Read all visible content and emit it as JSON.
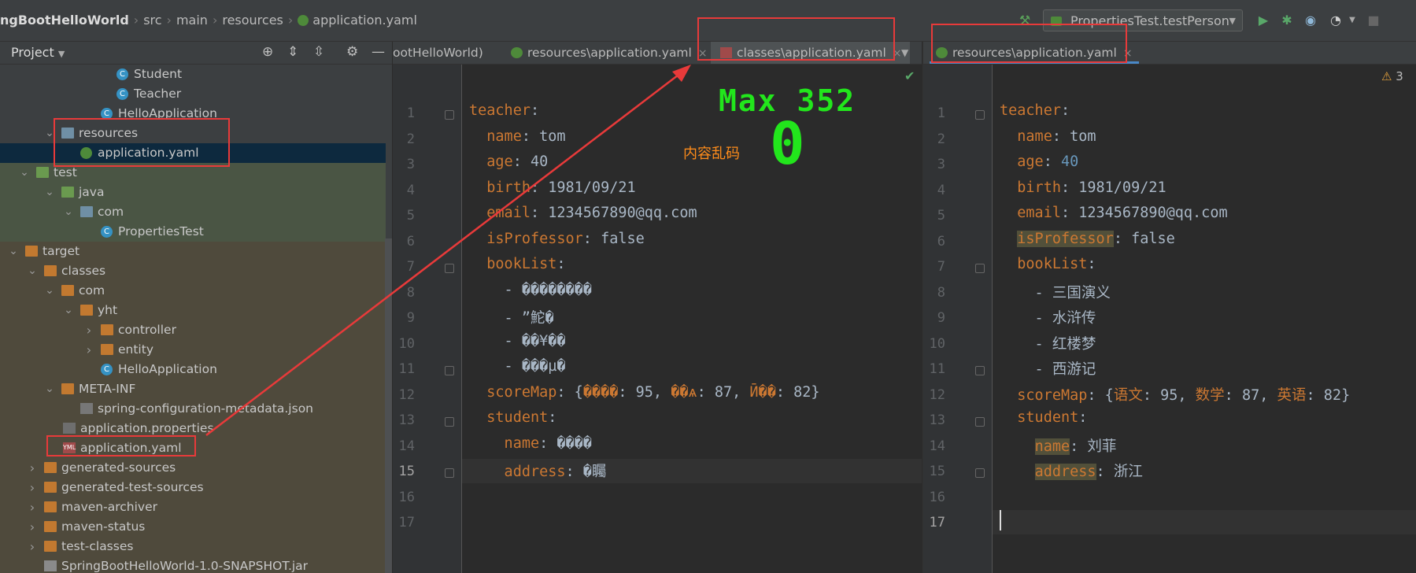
{
  "breadcrumb": {
    "project": "ngBootHelloWorld",
    "items": [
      "src",
      "main",
      "resources"
    ],
    "file": "application.yaml"
  },
  "toolbar": {
    "run_config": "PropertiesTest.testPerson"
  },
  "project_panel": {
    "title": "Project",
    "tree": [
      {
        "label": "Student",
        "icon": "class-icon",
        "indent": 148,
        "arrow": "",
        "bg": ""
      },
      {
        "label": "Teacher",
        "icon": "class-icon",
        "indent": 148,
        "arrow": "",
        "bg": ""
      },
      {
        "label": "HelloApplication",
        "icon": "spring-class-icon",
        "indent": 128,
        "arrow": "",
        "bg": ""
      },
      {
        "label": "resources",
        "icon": "resources-folder-icon",
        "indent": 78,
        "arrow": "▾",
        "bg": ""
      },
      {
        "label": "application.yaml",
        "icon": "spring-yaml-icon",
        "indent": 102,
        "arrow": "",
        "bg": "sel"
      },
      {
        "label": "test",
        "icon": "folder-green-icon",
        "indent": 46,
        "arrow": "▾",
        "bg": "green"
      },
      {
        "label": "java",
        "icon": "folder-green-icon",
        "indent": 78,
        "arrow": "▾",
        "bg": "green"
      },
      {
        "label": "com",
        "icon": "package-icon",
        "indent": 102,
        "arrow": "▾",
        "bg": "green"
      },
      {
        "label": "PropertiesTest",
        "icon": "spring-class-icon",
        "indent": 128,
        "arrow": "",
        "bg": "green"
      },
      {
        "label": "target",
        "icon": "folder-icon",
        "indent": 32,
        "arrow": "▾",
        "bg": "olive"
      },
      {
        "label": "classes",
        "icon": "folder-icon",
        "indent": 56,
        "arrow": "▾",
        "bg": "olive"
      },
      {
        "label": "com",
        "icon": "folder-icon",
        "indent": 78,
        "arrow": "▾",
        "bg": "olive"
      },
      {
        "label": "yht",
        "icon": "folder-icon",
        "indent": 102,
        "arrow": "▾",
        "bg": "olive"
      },
      {
        "label": "controller",
        "icon": "folder-icon",
        "indent": 128,
        "arrow": "›",
        "bg": "olive"
      },
      {
        "label": "entity",
        "icon": "folder-icon",
        "indent": 128,
        "arrow": "›",
        "bg": "olive"
      },
      {
        "label": "HelloApplication",
        "icon": "spring-class-icon",
        "indent": 128,
        "arrow": "",
        "bg": "olive"
      },
      {
        "label": "META-INF",
        "icon": "folder-icon",
        "indent": 78,
        "arrow": "▾",
        "bg": "olive"
      },
      {
        "label": "spring-configuration-metadata.json",
        "icon": "json-icon",
        "indent": 102,
        "arrow": "",
        "bg": "olive"
      },
      {
        "label": "application.properties",
        "icon": "properties-icon",
        "indent": 80,
        "arrow": "",
        "bg": "olive"
      },
      {
        "label": "application.yaml",
        "icon": "yaml-icon",
        "indent": 80,
        "arrow": "",
        "bg": "olive"
      },
      {
        "label": "generated-sources",
        "icon": "folder-icon",
        "indent": 56,
        "arrow": "›",
        "bg": "olive"
      },
      {
        "label": "generated-test-sources",
        "icon": "folder-icon",
        "indent": 56,
        "arrow": "›",
        "bg": "olive"
      },
      {
        "label": "maven-archiver",
        "icon": "folder-icon",
        "indent": 56,
        "arrow": "›",
        "bg": "olive"
      },
      {
        "label": "maven-status",
        "icon": "folder-icon",
        "indent": 56,
        "arrow": "›",
        "bg": "olive"
      },
      {
        "label": "test-classes",
        "icon": "folder-icon",
        "indent": 56,
        "arrow": "›",
        "bg": "olive"
      },
      {
        "label": "SpringBootHelloWorld-1.0-SNAPSHOT.jar",
        "icon": "jar-icon",
        "indent": 56,
        "arrow": "",
        "bg": "olive"
      }
    ]
  },
  "editor_left": {
    "tabs": [
      {
        "label": "ootHelloWorld)",
        "icon": "",
        "close": false
      },
      {
        "label": "resources\\application.yaml",
        "icon": "spring-yaml-icon",
        "close": true
      },
      {
        "label": "classes\\application.yaml",
        "icon": "yaml-icon",
        "close": true
      }
    ],
    "lines": [
      [
        {
          "t": "teacher",
          "c": "key"
        },
        {
          "t": ":",
          "c": "val"
        }
      ],
      [
        {
          "t": "  name",
          "c": "key"
        },
        {
          "t": ": tom",
          "c": "val"
        }
      ],
      [
        {
          "t": "  age",
          "c": "key"
        },
        {
          "t": ": 40",
          "c": "val"
        }
      ],
      [
        {
          "t": "  birth",
          "c": "key"
        },
        {
          "t": ": 1981/09/21",
          "c": "val"
        }
      ],
      [
        {
          "t": "  email",
          "c": "key"
        },
        {
          "t": ": 1234567890@qq.com",
          "c": "val"
        }
      ],
      [
        {
          "t": "  isProfessor",
          "c": "key"
        },
        {
          "t": ": false",
          "c": "val"
        }
      ],
      [
        {
          "t": "  bookList",
          "c": "key"
        },
        {
          "t": ":",
          "c": "val"
        }
      ],
      [
        {
          "t": "    - ��������",
          "c": "val"
        }
      ],
      [
        {
          "t": "    - ”鮀�",
          "c": "val"
        }
      ],
      [
        {
          "t": "    - ��¥��",
          "c": "val"
        }
      ],
      [
        {
          "t": "    - ���µ�",
          "c": "val"
        }
      ],
      [
        {
          "t": "  scoreMap",
          "c": "key"
        },
        {
          "t": ": {",
          "c": "val"
        },
        {
          "t": "����",
          "c": "key"
        },
        {
          "t": ": 95, ",
          "c": "val"
        },
        {
          "t": "��ѧ",
          "c": "key"
        },
        {
          "t": ": 87, ",
          "c": "val"
        },
        {
          "t": "Ӣ��",
          "c": "key"
        },
        {
          "t": ": 82}",
          "c": "val"
        }
      ],
      [
        {
          "t": "  student",
          "c": "key"
        },
        {
          "t": ":",
          "c": "val"
        }
      ],
      [
        {
          "t": "    name",
          "c": "key"
        },
        {
          "t": ": ����",
          "c": "val"
        }
      ],
      [
        {
          "t": "    address",
          "c": "key"
        },
        {
          "t": ": �矚",
          "c": "val"
        }
      ],
      [],
      []
    ]
  },
  "editor_right": {
    "tabs": [
      {
        "label": "resources\\application.yaml",
        "icon": "spring-yaml-icon",
        "close": true
      }
    ],
    "warning_count": "3",
    "lines": [
      [
        {
          "t": "teacher",
          "c": "key"
        },
        {
          "t": ":",
          "c": "val"
        }
      ],
      [
        {
          "t": "  name",
          "c": "key"
        },
        {
          "t": ": tom",
          "c": "val"
        }
      ],
      [
        {
          "t": "  age",
          "c": "key"
        },
        {
          "t": ": ",
          "c": "val"
        },
        {
          "t": "40",
          "c": "num"
        }
      ],
      [
        {
          "t": "  birth",
          "c": "key"
        },
        {
          "t": ": 1981/09/21",
          "c": "val"
        }
      ],
      [
        {
          "t": "  email",
          "c": "key"
        },
        {
          "t": ": 1234567890@qq.com",
          "c": "val"
        }
      ],
      [
        {
          "t": "  ",
          "c": "val"
        },
        {
          "t": "isProfessor",
          "c": "key warn"
        },
        {
          "t": ": false",
          "c": "val"
        }
      ],
      [
        {
          "t": "  bookList",
          "c": "key"
        },
        {
          "t": ":",
          "c": "val"
        }
      ],
      [
        {
          "t": "    - ",
          "c": "val"
        },
        {
          "t": "三国演义",
          "c": "val cjk"
        }
      ],
      [
        {
          "t": "    - ",
          "c": "val"
        },
        {
          "t": "水浒传",
          "c": "val cjk"
        }
      ],
      [
        {
          "t": "    - ",
          "c": "val"
        },
        {
          "t": "红楼梦",
          "c": "val cjk"
        }
      ],
      [
        {
          "t": "    - ",
          "c": "val"
        },
        {
          "t": "西游记",
          "c": "val cjk"
        }
      ],
      [
        {
          "t": "  scoreMap",
          "c": "key"
        },
        {
          "t": ": {",
          "c": "val"
        },
        {
          "t": "语文",
          "c": "key cjk"
        },
        {
          "t": ": 95, ",
          "c": "val"
        },
        {
          "t": "数学",
          "c": "key cjk"
        },
        {
          "t": ": 87, ",
          "c": "val"
        },
        {
          "t": "英语",
          "c": "key cjk"
        },
        {
          "t": ": 82}",
          "c": "val"
        }
      ],
      [
        {
          "t": "  student",
          "c": "key"
        },
        {
          "t": ":",
          "c": "val"
        }
      ],
      [
        {
          "t": "    ",
          "c": "val"
        },
        {
          "t": "name",
          "c": "key warn"
        },
        {
          "t": ": ",
          "c": "val"
        },
        {
          "t": "刘菲",
          "c": "val cjk"
        }
      ],
      [
        {
          "t": "    ",
          "c": "val"
        },
        {
          "t": "address",
          "c": "key warn"
        },
        {
          "t": ": ",
          "c": "val"
        },
        {
          "t": "浙江",
          "c": "val cjk"
        }
      ],
      [],
      []
    ]
  },
  "annotations": {
    "garbled_note": "内容乱码",
    "overlay_max": "Max 352",
    "overlay_zero": "0"
  },
  "colors": {
    "key": "#cc7832",
    "value": "#a9b7c6",
    "number": "#6897bb",
    "annotation_red": "#e83a3a",
    "overlay_green": "#22e61c"
  }
}
